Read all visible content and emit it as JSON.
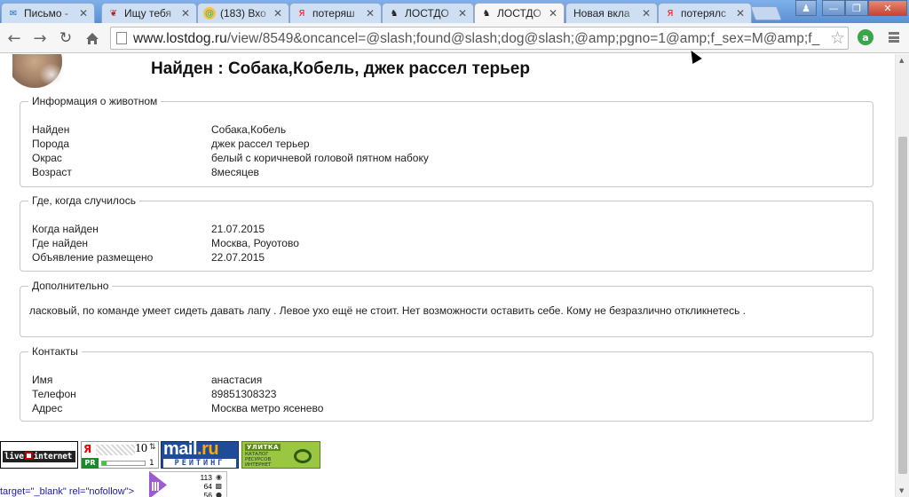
{
  "browser": {
    "tabs": [
      {
        "label": "Письмо -",
        "favicon": "mail-envelope-icon",
        "color": "#1a6fc8",
        "active": false
      },
      {
        "label": "Ищу тебя",
        "favicon": "paw-icon",
        "color": "#b22222",
        "active": false
      },
      {
        "label": "(183) Вхо",
        "favicon": "at-sign-icon",
        "color": "#d18b1a",
        "active": false
      },
      {
        "label": "потеряш",
        "favicon": "yandex-icon",
        "color": "#e61400",
        "active": false
      },
      {
        "label": "ЛОСТДО",
        "favicon": "dog-icon",
        "color": "#222222",
        "active": false
      },
      {
        "label": "ЛОСТДО",
        "favicon": "dog-icon",
        "color": "#222222",
        "active": true
      },
      {
        "label": "Новая вкла",
        "favicon": "",
        "color": "",
        "active": false
      },
      {
        "label": "потерялс",
        "favicon": "yandex-icon",
        "color": "#e61400",
        "active": false
      }
    ],
    "url_host": "www.lostdog.ru",
    "url_path": "/view/8549&oncancel=@slash;found@slash;dog@slash;@amp;pgno=1@amp;f_sex=M@amp;f_",
    "extension_letter": "a"
  },
  "page": {
    "title": "Найден : Собака,Кобель, джек рассел терьер",
    "sections": {
      "animal": {
        "legend": "Информация о животном",
        "rows": [
          {
            "key": "Найден",
            "value": "Собака,Кобель"
          },
          {
            "key": "Порода",
            "value": "джек рассел терьер"
          },
          {
            "key": "Окрас",
            "value": "белый с коричневой головой пятном набоку"
          },
          {
            "key": "Возраст",
            "value": "8месяцев"
          }
        ]
      },
      "where": {
        "legend": "Где, когда случилось",
        "rows": [
          {
            "key": "Когда найден",
            "value": "21.07.2015"
          },
          {
            "key": "Где найден",
            "value": "Москва, Роуотово"
          },
          {
            "key": "Объявление размещено",
            "value": "22.07.2015"
          }
        ]
      },
      "extra": {
        "legend": "Дополнительно",
        "text": "ласковый, по команде умеет сидеть давать лапу . Левое ухо ещё не стоит. Нет возможности оставить себе. Кому не безразлично откликнетесь ."
      },
      "contacts": {
        "legend": "Контакты",
        "rows": [
          {
            "key": "Имя",
            "value": "анастасия"
          },
          {
            "key": "Телефон",
            "value": "89851308323"
          },
          {
            "key": "Адрес",
            "value": "Москва метро ясенево"
          }
        ]
      }
    },
    "counters": {
      "liveinternet": {
        "part1": "live",
        "part2": "internet"
      },
      "yandex": {
        "logo": "Я",
        "tic": "10",
        "pr": "PR",
        "pr_value": "1",
        "pr_fraction": 0.1
      },
      "mailru": {
        "logo_a": "mail",
        "logo_b": ".ru",
        "caption": "РЕЙТИНГ"
      },
      "ulitka": {
        "title": "УЛИТКА",
        "caption": "КАТАЛОГ РЕСУРСОВ ИНТЕРНЕТ"
      },
      "stats": [
        "113",
        "64",
        "56"
      ]
    },
    "code_leak": "target=\"_blank\" rel=\"nofollow\">"
  }
}
